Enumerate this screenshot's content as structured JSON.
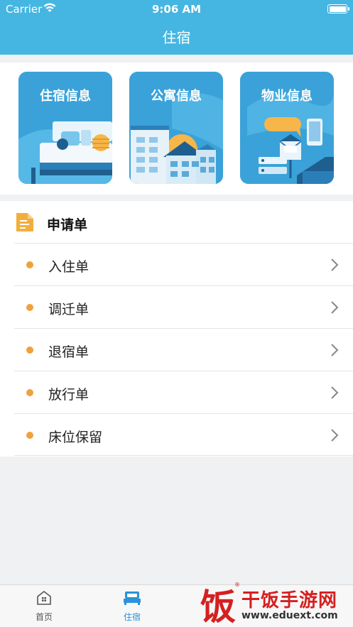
{
  "status_bar": {
    "carrier": "Carrier",
    "time": "9:06 AM"
  },
  "header": {
    "title": "住宿"
  },
  "cards": [
    {
      "label": "住宿信息",
      "icon": "bed-illustration"
    },
    {
      "label": "公寓信息",
      "icon": "apartment-illustration"
    },
    {
      "label": "物业信息",
      "icon": "property-illustration"
    }
  ],
  "section": {
    "title": "申请单",
    "items": [
      {
        "label": "入住单"
      },
      {
        "label": "调迁单"
      },
      {
        "label": "退宿单"
      },
      {
        "label": "放行单"
      },
      {
        "label": "床位保留"
      }
    ]
  },
  "tabbar": {
    "tabs": [
      {
        "label": "首页",
        "icon": "home-icon",
        "active": false
      },
      {
        "label": "住宿",
        "icon": "bed-icon",
        "active": true
      }
    ]
  },
  "watermark": {
    "char": "饭",
    "name": "干饭手游网",
    "url": "www.eduext.com"
  },
  "colors": {
    "header": "#45b6e2",
    "accent_dot": "#f0a13a",
    "active_tab": "#2b93d8",
    "watermark": "#d42020"
  }
}
